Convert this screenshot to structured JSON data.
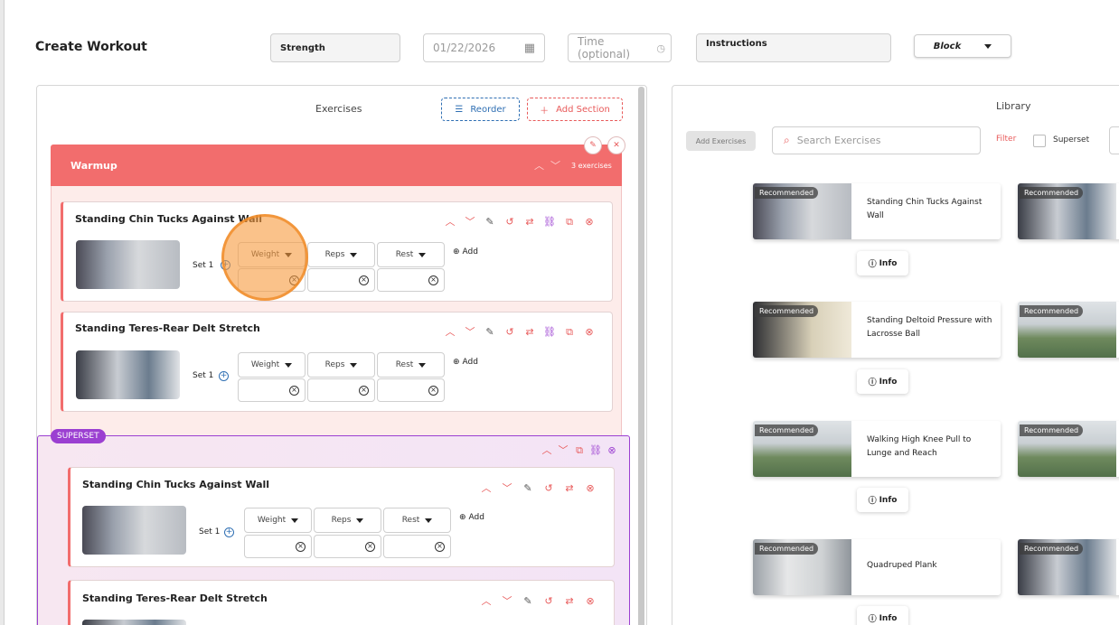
{
  "header": {
    "title": "Create Workout",
    "workout_type": "Strength",
    "date": "01/22/2026",
    "time_placeholder": "Time (optional)",
    "instructions_label": "Instructions",
    "block_label": "Block"
  },
  "exercises_panel": {
    "title": "Exercises",
    "reorder_label": "Reorder",
    "add_section_label": "Add Section",
    "warmup": {
      "title": "Warmup",
      "count": "3 exercises",
      "items": [
        {
          "name": "Standing Chin Tucks Against Wall",
          "set_label": "Set 1"
        },
        {
          "name": "Standing Teres-Rear Delt Stretch",
          "set_label": "Set 1"
        }
      ]
    },
    "superset": {
      "badge": "SUPERSET",
      "items": [
        {
          "name": "Standing Chin Tucks Against Wall",
          "set_label": "Set 1"
        },
        {
          "name": "Standing Teres-Rear Delt Stretch",
          "set_label": ""
        }
      ]
    },
    "columns": {
      "weight": "Weight",
      "reps": "Reps",
      "rest": "Rest",
      "add": "Add"
    }
  },
  "library_panel": {
    "title": "Library",
    "add_exercises_label": "Add Exercises",
    "search_placeholder": "Search Exercises",
    "filter_label": "Filter",
    "superset_label": "Superset",
    "badge": "Recommended",
    "info_label": "Info",
    "items": [
      {
        "name": "Standing Chin Tucks Against Wall"
      },
      {
        "name": "Standing Deltoid Pressure with Lacrosse Ball"
      },
      {
        "name": "Walking High Knee Pull to Lunge and Reach"
      },
      {
        "name": "Quadruped Plank"
      }
    ]
  },
  "colors": {
    "accent_red": "#f26d6d",
    "superset_purple": "#9b3fd1",
    "reorder_blue": "#2f6fb3",
    "click_highlight": "#f79a3c"
  }
}
